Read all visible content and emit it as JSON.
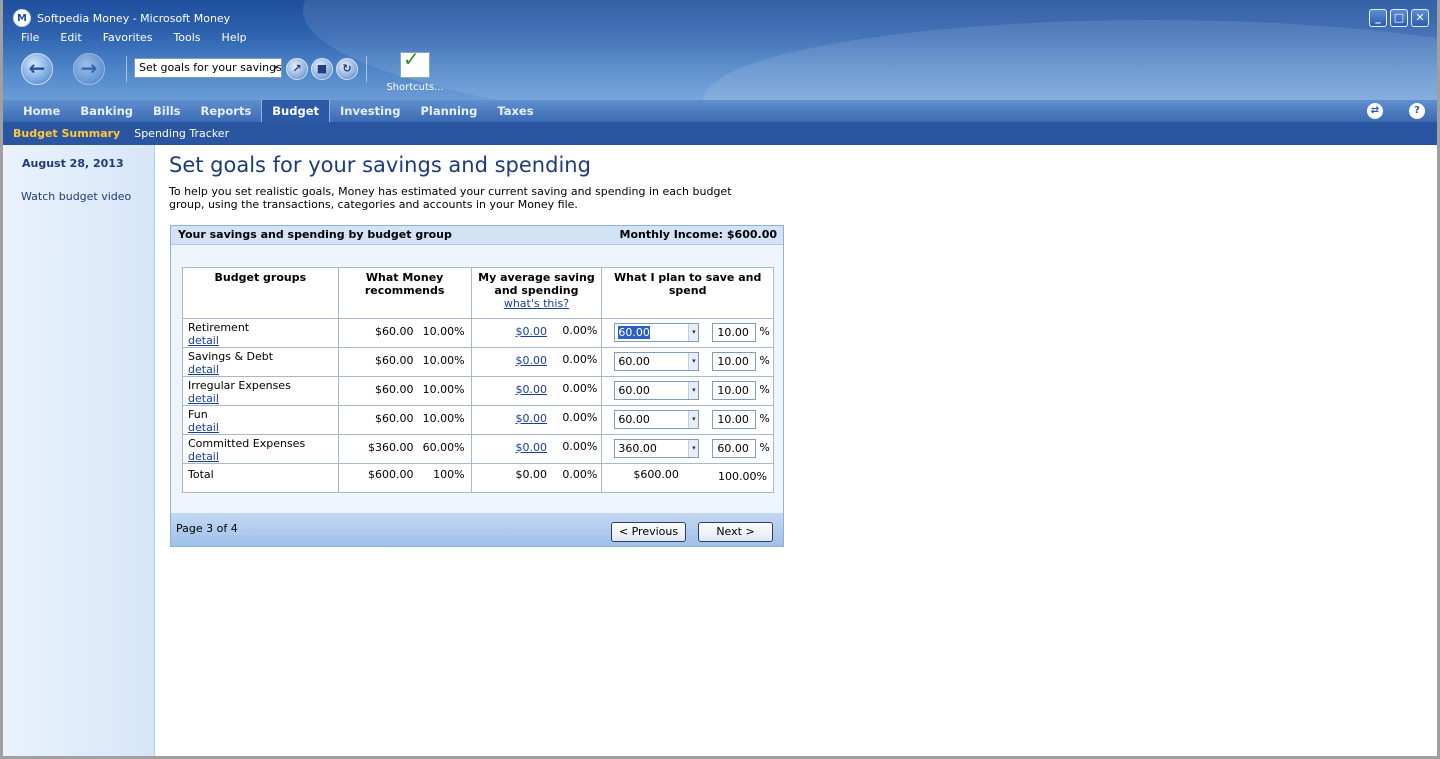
{
  "window": {
    "title": "Softpedia Money - Microsoft Money",
    "logo_letter": "M"
  },
  "menu": [
    "File",
    "Edit",
    "Favorites",
    "Tools",
    "Help"
  ],
  "toolbar": {
    "address_value": "Set goals for your savings a",
    "shortcuts_label": "Shortcuts..."
  },
  "tabs": [
    "Home",
    "Banking",
    "Bills",
    "Reports",
    "Budget",
    "Investing",
    "Planning",
    "Taxes"
  ],
  "active_tab": "Budget",
  "subnav": {
    "active": "Budget Summary",
    "other": "Spending Tracker"
  },
  "sidebar": {
    "date": "August 28, 2013",
    "video_link": "Watch budget video"
  },
  "main": {
    "title": "Set goals for your savings and spending",
    "intro": "To help you set realistic goals, Money has estimated your current saving and spending in each budget group, using the transactions, categories and accounts in your Money file."
  },
  "panel": {
    "heading": "Your savings and spending by budget group",
    "monthly_income": "Monthly Income: $600.00",
    "columns": {
      "group": "Budget groups",
      "recommend": "What Money recommends",
      "average": "My average saving and spending",
      "average_link": "what's this?",
      "plan": "What I plan to save and spend"
    },
    "rows": [
      {
        "name": "Retirement",
        "detail": "detail",
        "rec_amt": "$60.00",
        "rec_pct": "10.00%",
        "avg_amt": "$0.00",
        "avg_pct": "0.00%",
        "plan_amt": "60.00",
        "plan_pct": "10.00"
      },
      {
        "name": "Savings & Debt",
        "detail": "detail",
        "rec_amt": "$60.00",
        "rec_pct": "10.00%",
        "avg_amt": "$0.00",
        "avg_pct": "0.00%",
        "plan_amt": "60.00",
        "plan_pct": "10.00"
      },
      {
        "name": "Irregular Expenses",
        "detail": "detail",
        "rec_amt": "$60.00",
        "rec_pct": "10.00%",
        "avg_amt": "$0.00",
        "avg_pct": "0.00%",
        "plan_amt": "60.00",
        "plan_pct": "10.00"
      },
      {
        "name": "Fun",
        "detail": "detail",
        "rec_amt": "$60.00",
        "rec_pct": "10.00%",
        "avg_amt": "$0.00",
        "avg_pct": "0.00%",
        "plan_amt": "60.00",
        "plan_pct": "10.00"
      },
      {
        "name": "Committed Expenses",
        "detail": "detail",
        "rec_amt": "$360.00",
        "rec_pct": "60.00%",
        "avg_amt": "$0.00",
        "avg_pct": "0.00%",
        "plan_amt": "360.00",
        "plan_pct": "60.00"
      }
    ],
    "total": {
      "label": "Total",
      "rec_amt": "$600.00",
      "rec_pct": "100%",
      "avg_amt": "$0.00",
      "avg_pct": "0.00%",
      "plan_amt": "$600.00",
      "plan_pct": "100.00%"
    },
    "pct_sign": "%",
    "page_info": "Page 3 of 4",
    "prev_label": "< Previous",
    "next_label": "Next >"
  }
}
